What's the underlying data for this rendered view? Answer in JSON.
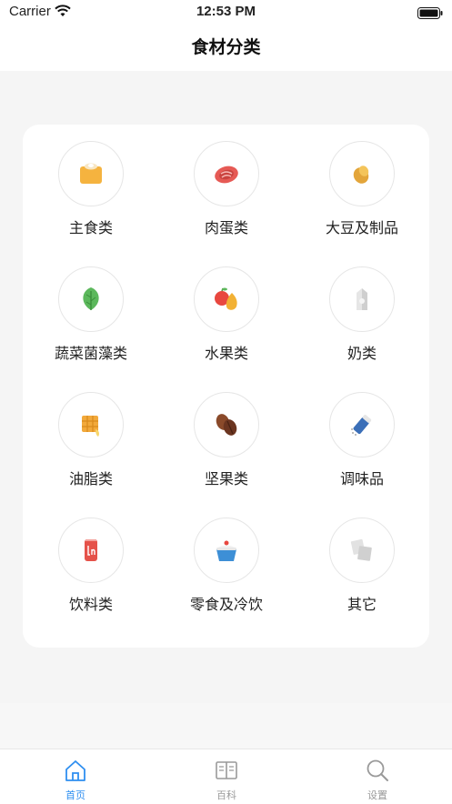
{
  "status": {
    "carrier": "Carrier",
    "time": "12:53 PM"
  },
  "nav": {
    "title": "食材分类"
  },
  "categories": [
    {
      "label": "主食类",
      "icon": "staple-food-icon"
    },
    {
      "label": "肉蛋类",
      "icon": "meat-icon"
    },
    {
      "label": "大豆及制品",
      "icon": "soybean-icon"
    },
    {
      "label": "蔬菜菌藻类",
      "icon": "vegetable-leaf-icon"
    },
    {
      "label": "水果类",
      "icon": "fruit-icon"
    },
    {
      "label": "奶类",
      "icon": "milk-carton-icon"
    },
    {
      "label": "油脂类",
      "icon": "butter-icon"
    },
    {
      "label": "坚果类",
      "icon": "nut-icon"
    },
    {
      "label": "调味品",
      "icon": "seasoning-shaker-icon"
    },
    {
      "label": "饮料类",
      "icon": "drink-can-icon"
    },
    {
      "label": "零食及冷饮",
      "icon": "cupcake-icon"
    },
    {
      "label": "其它",
      "icon": "other-items-icon"
    }
  ],
  "tabs": [
    {
      "label": "首页",
      "icon": "home-icon",
      "active": true
    },
    {
      "label": "百科",
      "icon": "book-icon",
      "active": false
    },
    {
      "label": "设置",
      "icon": "search-icon",
      "active": false
    }
  ],
  "colors": {
    "accent": "#2f8ff0",
    "inactive": "#999999"
  }
}
